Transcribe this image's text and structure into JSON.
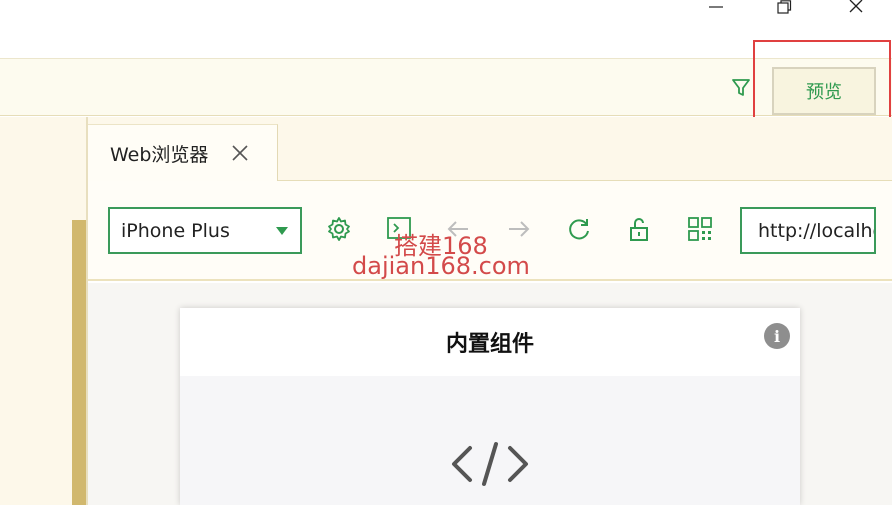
{
  "window": {
    "minimize_icon": "minimize-icon",
    "maximize_icon": "restore-icon",
    "close_icon": "close-icon"
  },
  "toolbar": {
    "filter_icon": "filter-icon",
    "preview_label": "预览"
  },
  "tabs": [
    {
      "label": "Web浏览器",
      "close_icon": "close-icon"
    }
  ],
  "browser": {
    "device_selected": "iPhone Plus",
    "icons": [
      "gear-icon",
      "inspector-icon",
      "back-arrow-icon",
      "forward-arrow-icon",
      "refresh-icon",
      "unlock-icon",
      "qrcode-icon"
    ],
    "url": "http://localhost"
  },
  "watermark": {
    "line1": "搭建168",
    "line2": "dajian168.com"
  },
  "preview": {
    "header_title": "内置组件",
    "info_label": "i",
    "body_icon": "code-icon"
  },
  "colors": {
    "accent_green": "#2f9a4f",
    "highlight_red": "#e04040",
    "panel_cream": "#fdf8ea",
    "strip_gold": "#d1b86e"
  }
}
